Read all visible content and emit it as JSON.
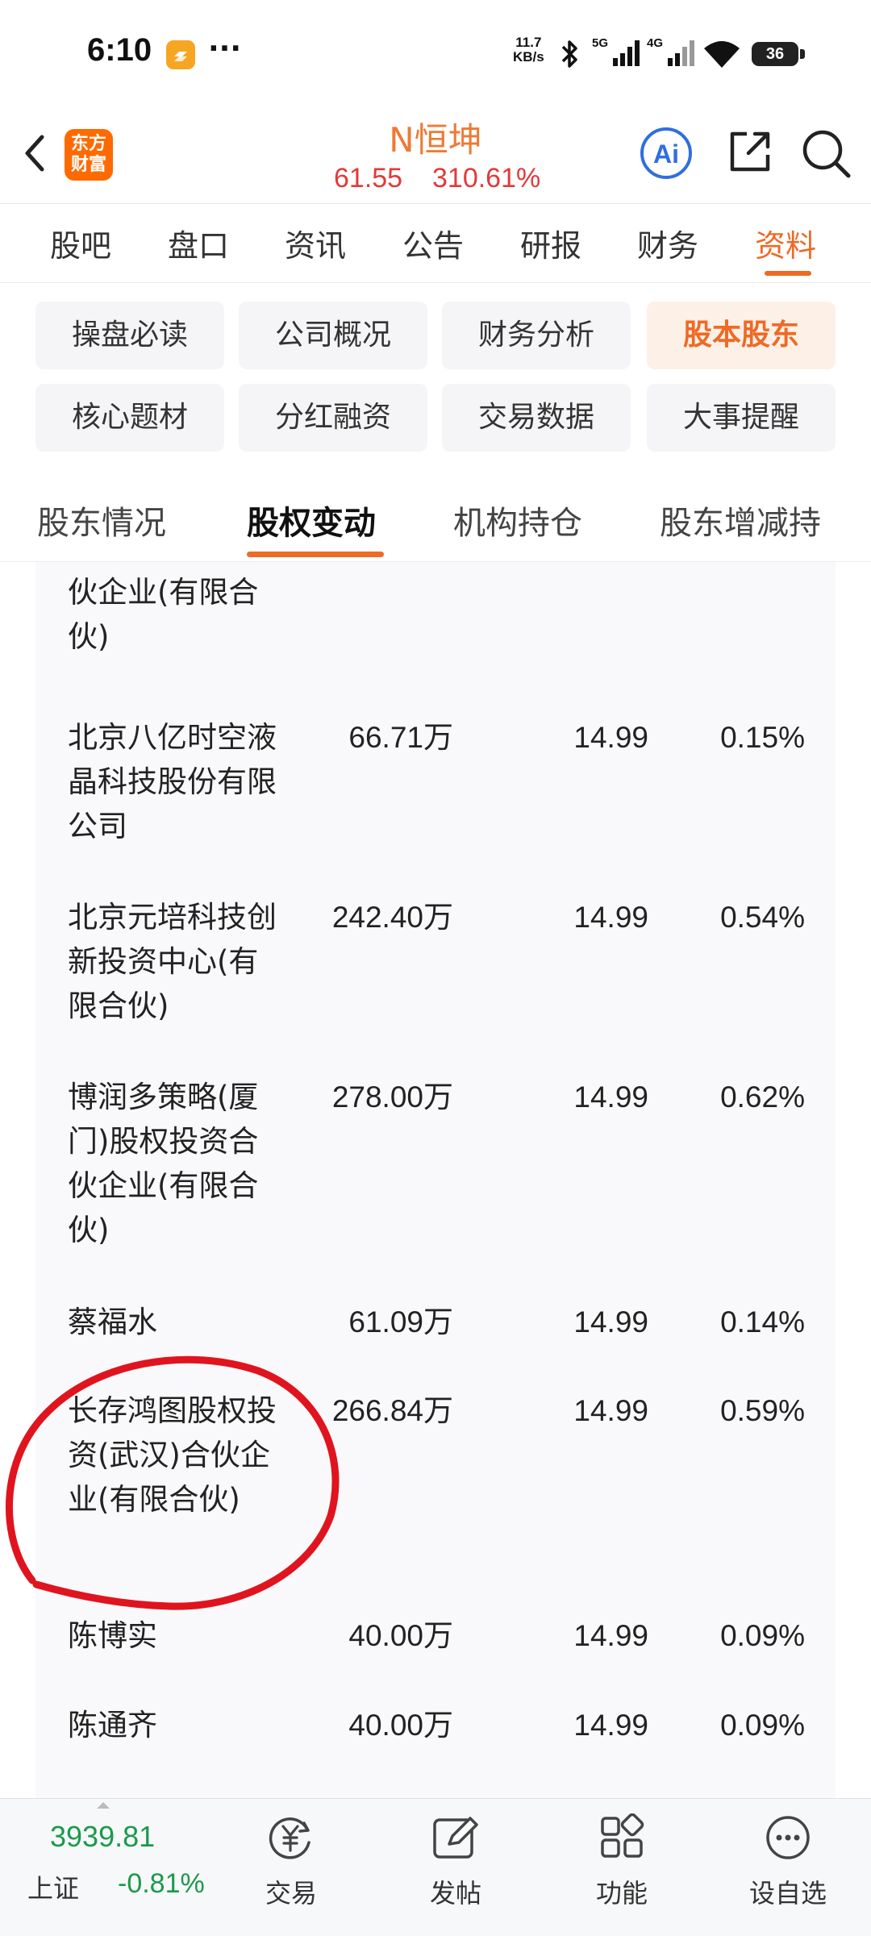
{
  "status_bar": {
    "time": "6:10",
    "more": "···",
    "net_speed_value": "11.7",
    "net_speed_unit": "KB/s",
    "sig1_label": "5G",
    "sig2_label": "4G",
    "battery": "36"
  },
  "header": {
    "logo_line1": "东方",
    "logo_line2": "财富",
    "stock_name": "N恒坤",
    "price": "61.55",
    "change_pct": "310.61%",
    "ai_label": "Ai"
  },
  "tabs": [
    "股吧",
    "盘口",
    "资讯",
    "公告",
    "研报",
    "财务",
    "资料"
  ],
  "active_tab": "资料",
  "subtabs": [
    "操盘必读",
    "公司概况",
    "财务分析",
    "股本股东",
    "核心题材",
    "分红融资",
    "交易数据",
    "大事提醒"
  ],
  "active_subtab": "股本股东",
  "section_tabs": [
    "股东情况",
    "股权变动",
    "机构持仓",
    "股东增减持"
  ],
  "active_section_tab": "股权变动",
  "table": {
    "rows": [
      {
        "name": "投东应策基业合伙企业(有限合伙)",
        "shares": "",
        "price": "",
        "ratio": ""
      },
      {
        "name": "北京八亿时空液晶科技股份有限公司",
        "shares": "66.71万",
        "price": "14.99",
        "ratio": "0.15%"
      },
      {
        "name": "北京元培科技创新投资中心(有限合伙)",
        "shares": "242.40万",
        "price": "14.99",
        "ratio": "0.54%"
      },
      {
        "name": "博润多策略(厦门)股权投资合伙企业(有限合伙)",
        "shares": "278.00万",
        "price": "14.99",
        "ratio": "0.62%"
      },
      {
        "name": "蔡福水",
        "shares": "61.09万",
        "price": "14.99",
        "ratio": "0.14%"
      },
      {
        "name": "长存鸿图股权投资(武汉)合伙企业(有限合伙)",
        "shares": "266.84万",
        "price": "14.99",
        "ratio": "0.59%"
      },
      {
        "name": "陈博实",
        "shares": "40.00万",
        "price": "14.99",
        "ratio": "0.09%"
      },
      {
        "name": "陈通齐",
        "shares": "40.00万",
        "price": "14.99",
        "ratio": "0.09%"
      }
    ]
  },
  "bottom_bar": {
    "index_value": "3939.81",
    "index_name": "上证",
    "index_change": "-0.81%",
    "nav": [
      "交易",
      "发帖",
      "功能",
      "设自选"
    ]
  },
  "colors": {
    "accent": "#ee6a25",
    "price_up": "#e23a3a",
    "price_down": "#1a9a4a",
    "annotation": "#e0141e"
  }
}
